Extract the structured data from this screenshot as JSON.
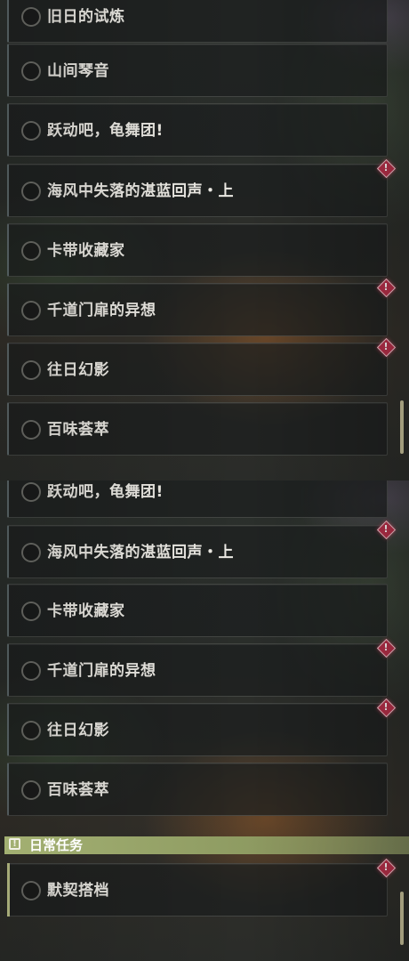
{
  "panels": [
    {
      "quests": [
        {
          "label": "旧日的试炼",
          "alert": false
        },
        {
          "label": "山间琴音",
          "alert": false
        },
        {
          "label": "跃动吧，龟舞团!",
          "alert": false
        },
        {
          "label": "海风中失落的湛蓝回声・上",
          "alert": true
        },
        {
          "label": "卡带收藏家",
          "alert": false
        },
        {
          "label": "千道门扉的异想",
          "alert": true
        },
        {
          "label": "往日幻影",
          "alert": true
        },
        {
          "label": "百味荟萃",
          "alert": false
        }
      ]
    },
    {
      "quests": [
        {
          "label": "跃动吧，龟舞团!",
          "alert": false
        },
        {
          "label": "海风中失落的湛蓝回声・上",
          "alert": true
        },
        {
          "label": "卡带收藏家",
          "alert": false
        },
        {
          "label": "千道门扉的异想",
          "alert": true
        },
        {
          "label": "往日幻影",
          "alert": true
        },
        {
          "label": "百味荟萃",
          "alert": false
        }
      ],
      "section": {
        "title": "日常任务",
        "icon": "exclamation-square-icon",
        "quests": [
          {
            "label": "默契搭档",
            "alert": true
          }
        ]
      }
    }
  ],
  "icons": {
    "status": "empty-circle-icon",
    "alert": "red-diamond-exclamation-icon"
  },
  "colors": {
    "alert": "#b8304a",
    "section": "#a3b072",
    "scrollbar": "#c9c29a",
    "text": "#eeece6"
  }
}
